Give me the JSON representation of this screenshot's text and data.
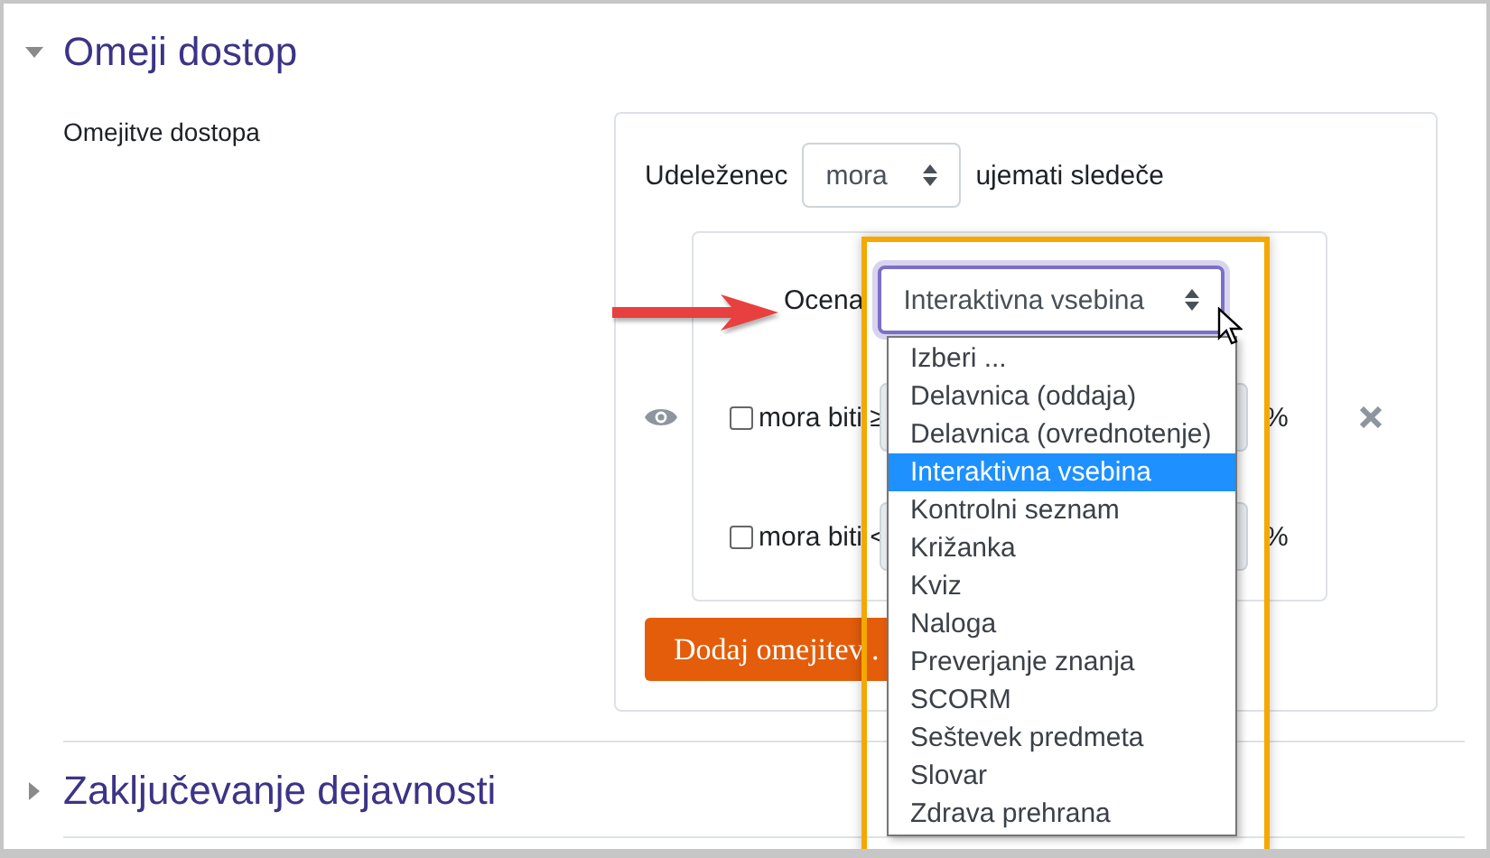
{
  "section": {
    "title": "Omeji dostop",
    "expanded": true
  },
  "field_label": "Omejitve dostopa",
  "restriction": {
    "prefix": "Udeleženec",
    "mode_select": "mora",
    "suffix": "ujemati sledeče",
    "condition": {
      "label": "Ocena",
      "activity_select": "Interaktivna vsebina",
      "rows": [
        {
          "label": "mora biti ≥",
          "checked": false,
          "disabled": true,
          "unit": "%"
        },
        {
          "label": "mora biti <",
          "checked": false,
          "disabled": true,
          "unit": "%"
        }
      ]
    },
    "add_button": "Dodaj omejitev ."
  },
  "dropdown": {
    "options": [
      {
        "label": "Izberi ...",
        "selected": false
      },
      {
        "label": "Delavnica (oddaja)",
        "selected": false
      },
      {
        "label": "Delavnica (ovrednotenje)",
        "selected": false
      },
      {
        "label": "Interaktivna vsebina",
        "selected": true
      },
      {
        "label": "Kontrolni seznam",
        "selected": false
      },
      {
        "label": "Križanka",
        "selected": false
      },
      {
        "label": "Kviz",
        "selected": false
      },
      {
        "label": "Naloga",
        "selected": false
      },
      {
        "label": "Preverjanje znanja",
        "selected": false
      },
      {
        "label": "SCORM",
        "selected": false
      },
      {
        "label": "Seštevek predmeta",
        "selected": false
      },
      {
        "label": "Slovar",
        "selected": false
      },
      {
        "label": "Zdrava prehrana",
        "selected": false
      }
    ]
  },
  "next_section": {
    "title": "Zaključevanje dejavnosti",
    "expanded": false
  }
}
